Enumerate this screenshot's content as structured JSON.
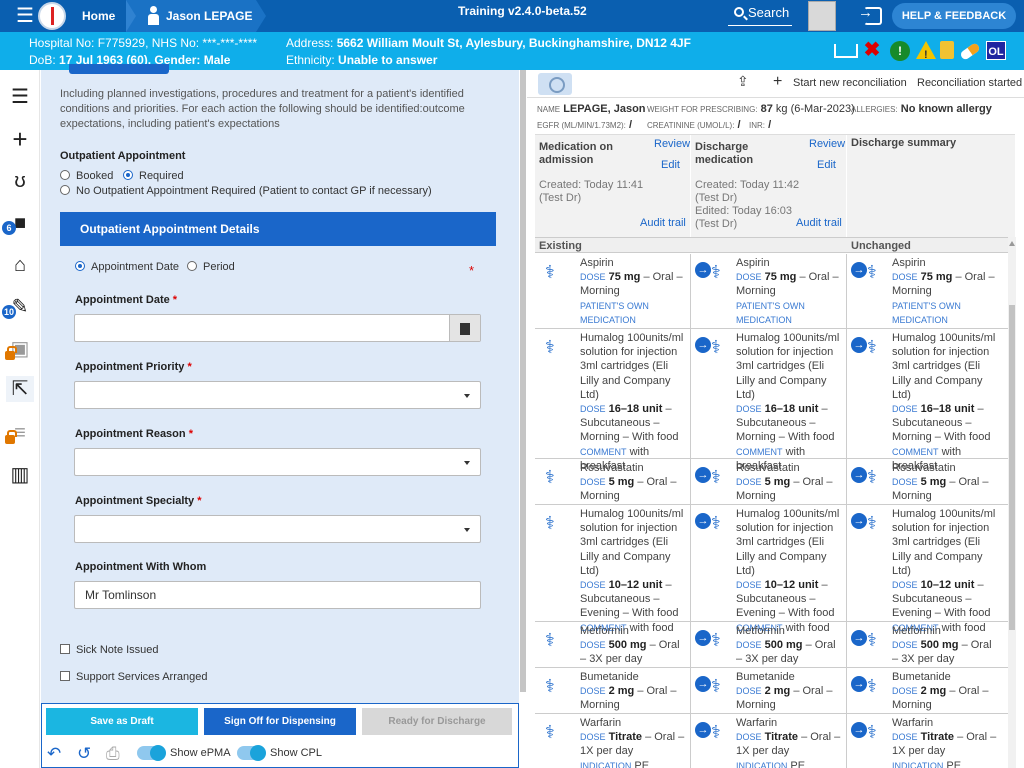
{
  "topbar": {
    "home": "Home",
    "patient": "Jason LEPAGE",
    "training": "Training v2.4.0-beta.52",
    "search": "Search",
    "help": "HELP & FEEDBACK"
  },
  "patient": {
    "hospital_no": "Hospital No: F775929, NHS No: ***-***-****",
    "dob_label": "DoB: ",
    "dob": "17 Jul 1963 (60), Gender: Male",
    "address_label": "Address: ",
    "address": "5662 William Moult St, Aylesbury, Buckinghamshire, DN12 4JF",
    "ethnicity_label": "Ethnicity: ",
    "ethnicity": "Unable to answer",
    "alert_ol": "OL"
  },
  "sidebar": {
    "badge1": "6",
    "badge2": "10"
  },
  "form": {
    "intro": "Including planned investigations, procedures and treatment for a patient's identified conditions and priorities. For each action the following should be identified:outcome expectations, including patient's expectations",
    "outpatient_label": "Outpatient Appointment",
    "opt_booked": "Booked",
    "opt_required": "Required",
    "opt_none": "No Outpatient Appointment Required (Patient to contact GP if necessary)",
    "details_title": "Outpatient Appointment Details",
    "opt_date": "Appointment Date",
    "opt_period": "Period",
    "date_label": "Appointment Date",
    "priority_label": "Appointment Priority",
    "reason_label": "Appointment Reason",
    "specialty_label": "Appointment Specialty",
    "whom_label": "Appointment With Whom",
    "whom_value": "Mr Tomlinson",
    "sick_note": "Sick Note Issued",
    "support": "Support Services Arranged"
  },
  "footer": {
    "draft": "Save as Draft",
    "signoff": "Sign Off for Dispensing",
    "ready": "Ready for Discharge",
    "show_epma": "Show ePMA",
    "show_cpl": "Show CPL"
  },
  "recon": {
    "start": "Start new reconciliation",
    "started": "Reconciliation started",
    "name_label": "NAME",
    "name": "LEPAGE, Jason",
    "weight_label": "WEIGHT FOR PRESCRIBING:",
    "weight": "87",
    "weight_rest": "kg (6-Mar-2023)",
    "allergies_label": "ALLERGIES:",
    "allergies": "No known allergy",
    "egfr_label": "EGFR (ML/MIN/1.73M2):",
    "egfr": "/",
    "creat_label": "CREATININE (UMOL/L):",
    "creat": "/",
    "inr_label": "INR:",
    "inr": "/",
    "col1_title": "Medication on admission",
    "col2_title": "Discharge medication",
    "col3_title": "Discharge summary",
    "review": "Review",
    "edit": "Edit",
    "audit": "Audit trail",
    "col1_created": "Created: Today 11:41",
    "col1_by": "(Test Dr)",
    "col2_created": "Created: Today 11:42",
    "col2_by": "(Test Dr)",
    "col2_edited": "Edited: Today 16:03",
    "col2_by2": "(Test Dr)",
    "h_existing": "Existing",
    "h_unchanged": "Unchanged"
  },
  "meds": [
    {
      "name": "Aspirin",
      "dose": "75 mg",
      "l2": "– Oral –",
      "l3": "Morning",
      "extra": "PATIENT'S OWN MEDICATION"
    },
    {
      "name": "Humalog 100units/ml solution for injection 3ml cartridges (Eli Lilly and Company Ltd)",
      "dose": "16–18 unit",
      "l2": "–",
      "l3": "Subcutaneous – Morning – With food",
      "comment": "with breakfast"
    },
    {
      "name": "Rosuvastatin",
      "dose": "5 mg",
      "l2": "– Oral –",
      "l3": "Morning"
    },
    {
      "name": "Humalog 100units/ml solution for injection 3ml cartridges (Eli Lilly and Company Ltd)",
      "dose": "10–12 unit",
      "l2": "–",
      "l3": "Subcutaneous – Evening – With food",
      "comment": "with food"
    },
    {
      "name": "Metformin",
      "dose": "500 mg",
      "l2": "– Oral –",
      "l3": "3X per day"
    },
    {
      "name": "Bumetanide",
      "dose": "2 mg",
      "l2": "– Oral –",
      "l3": "Morning"
    },
    {
      "name": "Warfarin",
      "dose": "Titrate",
      "l2": "– Oral –",
      "l3": "1X per day",
      "indication": "PE"
    }
  ]
}
